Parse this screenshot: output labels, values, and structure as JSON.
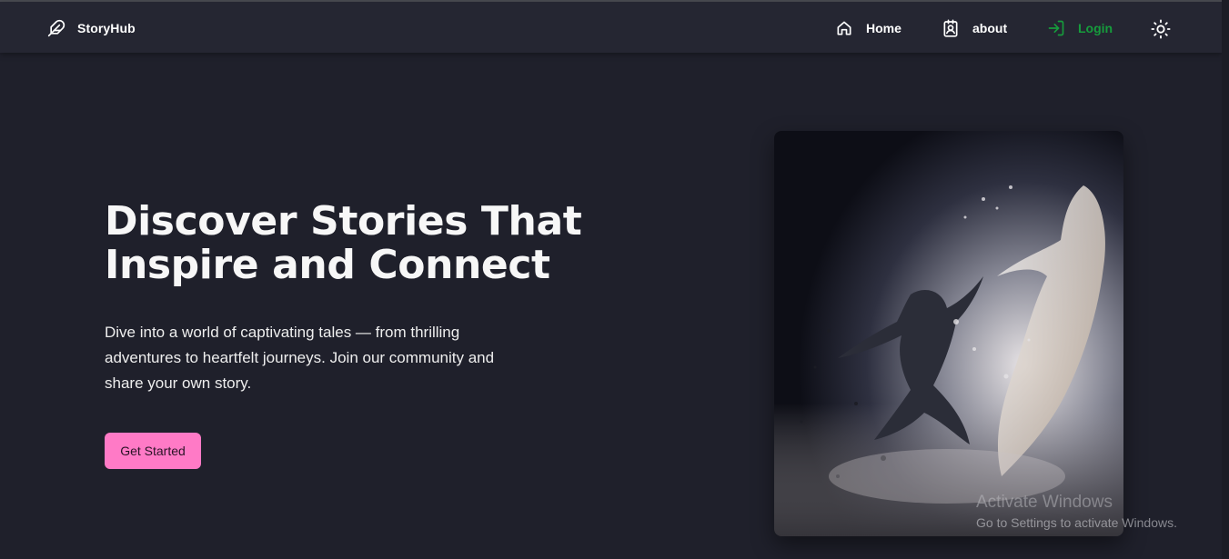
{
  "navbar": {
    "brand": {
      "name": "StoryHub",
      "icon": "feather-icon"
    },
    "items": [
      {
        "label": "Home",
        "icon": "home-icon"
      },
      {
        "label": "about",
        "icon": "contact-badge-icon"
      },
      {
        "label": "Login",
        "icon": "login-icon",
        "color": "#169c3c"
      }
    ],
    "theme_toggle": {
      "icon": "sun-icon"
    }
  },
  "hero": {
    "title": "Discover Stories That Inspire and Connect",
    "description": "Dive into a world of captivating tales — from thrilling adventures to heartfelt journeys. Join our community and share your own story.",
    "cta_label": "Get Started",
    "cta_color": "#ff7ac6"
  },
  "watermark": {
    "title": "Activate Windows",
    "subtitle": "Go to Settings to activate Windows."
  },
  "colors": {
    "background": "#1f202b",
    "navbar": "#252632"
  }
}
